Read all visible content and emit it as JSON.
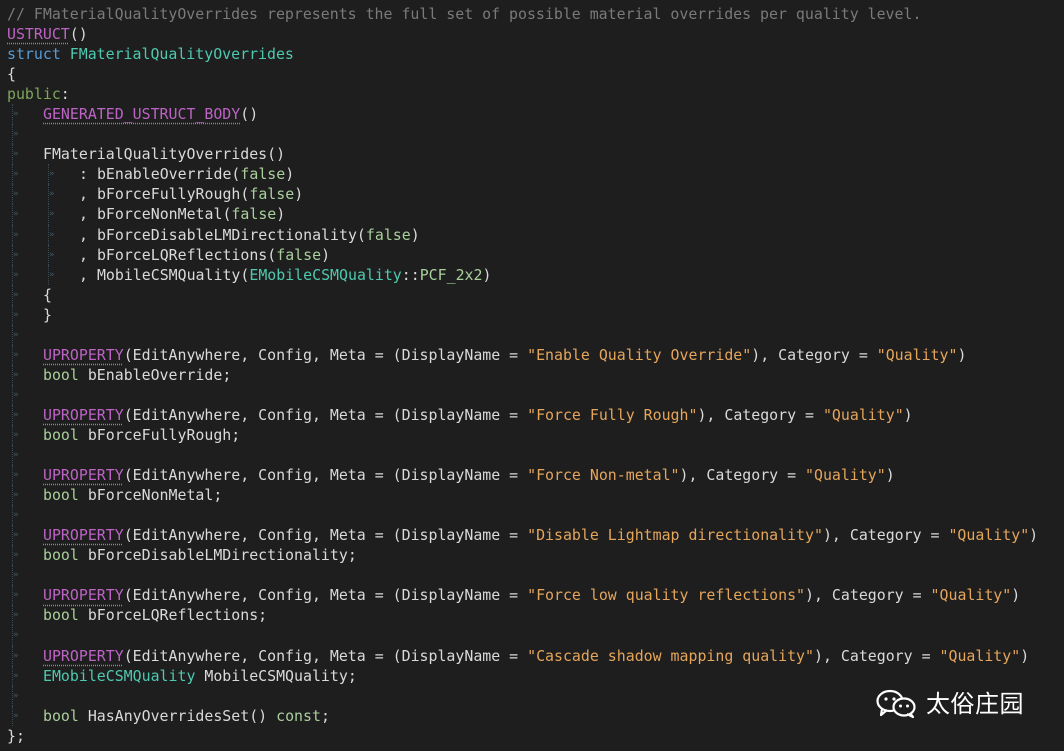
{
  "theme": {
    "background": "#1e1e1e",
    "comment": "#7a7a7a",
    "keyword": "#569cd6",
    "macro": "#bd63c5",
    "string": "#e5a55b",
    "type": "#4ec9b0",
    "identifier": "#dadada",
    "bool": "#a9d09c",
    "watermark": "#ffffff"
  },
  "code": {
    "lines": [
      {
        "parts": [
          {
            "t": "// FMaterialQualityOverrides represents the full set of possible material overrides per quality level.",
            "c": "comment-gray"
          }
        ]
      },
      {
        "parts": [
          {
            "t": "USTRUCT",
            "c": "macro",
            "u": true
          },
          {
            "t": "()",
            "c": "identifier"
          }
        ]
      },
      {
        "parts": [
          {
            "t": "struct ",
            "c": "keyword"
          },
          {
            "t": "FMaterialQualityOverrides",
            "c": "type"
          }
        ]
      },
      {
        "parts": [
          {
            "t": "{",
            "c": "identifier"
          }
        ]
      },
      {
        "parts": [
          {
            "t": "public",
            "c": "public"
          },
          {
            "t": ":",
            "c": "identifier"
          }
        ]
      },
      {
        "indent": 1,
        "parts": [
          {
            "t": "GENERATED_USTRUCT_BODY",
            "c": "macro",
            "u": true
          },
          {
            "t": "()",
            "c": "identifier"
          }
        ]
      },
      {
        "parts": []
      },
      {
        "indent": 1,
        "parts": [
          {
            "t": "FMaterialQualityOverrides",
            "c": "identifier"
          },
          {
            "t": "()",
            "c": "identifier"
          }
        ]
      },
      {
        "indent": 2,
        "parts": [
          {
            "t": ": ",
            "c": "identifier"
          },
          {
            "t": "bEnableOverride",
            "c": "identifier"
          },
          {
            "t": "(",
            "c": "identifier"
          },
          {
            "t": "false",
            "c": "bool"
          },
          {
            "t": ")",
            "c": "identifier"
          }
        ]
      },
      {
        "indent": 2,
        "parts": [
          {
            "t": ", ",
            "c": "identifier"
          },
          {
            "t": "bForceFullyRough",
            "c": "identifier"
          },
          {
            "t": "(",
            "c": "identifier"
          },
          {
            "t": "false",
            "c": "bool"
          },
          {
            "t": ")",
            "c": "identifier"
          }
        ]
      },
      {
        "indent": 2,
        "parts": [
          {
            "t": ", ",
            "c": "identifier"
          },
          {
            "t": "bForceNonMetal",
            "c": "identifier"
          },
          {
            "t": "(",
            "c": "identifier"
          },
          {
            "t": "false",
            "c": "bool"
          },
          {
            "t": ")",
            "c": "identifier"
          }
        ]
      },
      {
        "indent": 2,
        "parts": [
          {
            "t": ", ",
            "c": "identifier"
          },
          {
            "t": "bForceDisableLMDirectionality",
            "c": "identifier"
          },
          {
            "t": "(",
            "c": "identifier"
          },
          {
            "t": "false",
            "c": "bool"
          },
          {
            "t": ")",
            "c": "identifier"
          }
        ]
      },
      {
        "indent": 2,
        "parts": [
          {
            "t": ", ",
            "c": "identifier"
          },
          {
            "t": "bForceLQReflections",
            "c": "identifier"
          },
          {
            "t": "(",
            "c": "identifier"
          },
          {
            "t": "false",
            "c": "bool"
          },
          {
            "t": ")",
            "c": "identifier"
          }
        ]
      },
      {
        "indent": 2,
        "parts": [
          {
            "t": ", ",
            "c": "identifier"
          },
          {
            "t": "MobileCSMQuality",
            "c": "identifier"
          },
          {
            "t": "(",
            "c": "identifier"
          },
          {
            "t": "EMobileCSMQuality",
            "c": "type"
          },
          {
            "t": "::",
            "c": "identifier"
          },
          {
            "t": "PCF_2x2",
            "c": "bool"
          },
          {
            "t": ")",
            "c": "identifier"
          }
        ]
      },
      {
        "indent": 1,
        "parts": [
          {
            "t": "{",
            "c": "identifier"
          }
        ]
      },
      {
        "indent": 1,
        "parts": [
          {
            "t": "}",
            "c": "identifier"
          }
        ]
      },
      {
        "parts": []
      },
      {
        "indent": 1,
        "parts": [
          {
            "t": "UPROPERTY",
            "c": "macro",
            "u": true
          },
          {
            "t": "(EditAnywhere, Config, Meta = (DisplayName = ",
            "c": "identifier"
          },
          {
            "t": "\"Enable Quality Override\"",
            "c": "string"
          },
          {
            "t": "), Category = ",
            "c": "identifier"
          },
          {
            "t": "\"Quality\"",
            "c": "string"
          },
          {
            "t": ")",
            "c": "identifier"
          }
        ]
      },
      {
        "indent": 1,
        "parts": [
          {
            "t": "bool ",
            "c": "bool"
          },
          {
            "t": "bEnableOverride",
            "c": "identifier"
          },
          {
            "t": ";",
            "c": "identifier"
          }
        ]
      },
      {
        "parts": []
      },
      {
        "indent": 1,
        "parts": [
          {
            "t": "UPROPERTY",
            "c": "macro",
            "u": true
          },
          {
            "t": "(EditAnywhere, Config, Meta = (DisplayName = ",
            "c": "identifier"
          },
          {
            "t": "\"Force Fully Rough\"",
            "c": "string"
          },
          {
            "t": "), Category = ",
            "c": "identifier"
          },
          {
            "t": "\"Quality\"",
            "c": "string"
          },
          {
            "t": ")",
            "c": "identifier"
          }
        ]
      },
      {
        "indent": 1,
        "parts": [
          {
            "t": "bool ",
            "c": "bool"
          },
          {
            "t": "bForceFullyRough",
            "c": "identifier"
          },
          {
            "t": ";",
            "c": "identifier"
          }
        ]
      },
      {
        "parts": []
      },
      {
        "indent": 1,
        "parts": [
          {
            "t": "UPROPERTY",
            "c": "macro",
            "u": true
          },
          {
            "t": "(EditAnywhere, Config, Meta = (DisplayName = ",
            "c": "identifier"
          },
          {
            "t": "\"Force Non-metal\"",
            "c": "string"
          },
          {
            "t": "), Category = ",
            "c": "identifier"
          },
          {
            "t": "\"Quality\"",
            "c": "string"
          },
          {
            "t": ")",
            "c": "identifier"
          }
        ]
      },
      {
        "indent": 1,
        "parts": [
          {
            "t": "bool ",
            "c": "bool"
          },
          {
            "t": "bForceNonMetal",
            "c": "identifier"
          },
          {
            "t": ";",
            "c": "identifier"
          }
        ]
      },
      {
        "parts": []
      },
      {
        "indent": 1,
        "parts": [
          {
            "t": "UPROPERTY",
            "c": "macro",
            "u": true
          },
          {
            "t": "(EditAnywhere, Config, Meta = (DisplayName = ",
            "c": "identifier"
          },
          {
            "t": "\"Disable Lightmap directionality\"",
            "c": "string"
          },
          {
            "t": "), Category = ",
            "c": "identifier"
          },
          {
            "t": "\"Quality\"",
            "c": "string"
          },
          {
            "t": ")",
            "c": "identifier"
          }
        ]
      },
      {
        "indent": 1,
        "parts": [
          {
            "t": "bool ",
            "c": "bool"
          },
          {
            "t": "bForceDisableLMDirectionality",
            "c": "identifier"
          },
          {
            "t": ";",
            "c": "identifier"
          }
        ]
      },
      {
        "parts": []
      },
      {
        "indent": 1,
        "parts": [
          {
            "t": "UPROPERTY",
            "c": "macro",
            "u": true
          },
          {
            "t": "(EditAnywhere, Config, Meta = (DisplayName = ",
            "c": "identifier"
          },
          {
            "t": "\"Force low quality reflections\"",
            "c": "string"
          },
          {
            "t": "), Category = ",
            "c": "identifier"
          },
          {
            "t": "\"Quality\"",
            "c": "string"
          },
          {
            "t": ")",
            "c": "identifier"
          }
        ]
      },
      {
        "indent": 1,
        "parts": [
          {
            "t": "bool ",
            "c": "bool"
          },
          {
            "t": "bForceLQReflections",
            "c": "identifier"
          },
          {
            "t": ";",
            "c": "identifier"
          }
        ]
      },
      {
        "parts": []
      },
      {
        "indent": 1,
        "parts": [
          {
            "t": "UPROPERTY",
            "c": "macro",
            "u": true
          },
          {
            "t": "(EditAnywhere, Config, Meta = (DisplayName = ",
            "c": "identifier"
          },
          {
            "t": "\"Cascade shadow mapping quality\"",
            "c": "string"
          },
          {
            "t": "), Category = ",
            "c": "identifier"
          },
          {
            "t": "\"Quality\"",
            "c": "string"
          },
          {
            "t": ")",
            "c": "identifier"
          }
        ]
      },
      {
        "indent": 1,
        "parts": [
          {
            "t": "EMobileCSMQuality ",
            "c": "type"
          },
          {
            "t": "MobileCSMQuality",
            "c": "identifier"
          },
          {
            "t": ";",
            "c": "identifier"
          }
        ]
      },
      {
        "parts": []
      },
      {
        "indent": 1,
        "parts": [
          {
            "t": "bool ",
            "c": "bool"
          },
          {
            "t": "HasAnyOverridesSet",
            "c": "identifier"
          },
          {
            "t": "() ",
            "c": "identifier"
          },
          {
            "t": "const",
            "c": "bool"
          },
          {
            "t": ";",
            "c": "identifier"
          }
        ]
      },
      {
        "parts": [
          {
            "t": "};",
            "c": "identifier"
          }
        ]
      }
    ]
  },
  "watermark": {
    "text": "太俗庄园",
    "icon": "wechat-icon"
  }
}
